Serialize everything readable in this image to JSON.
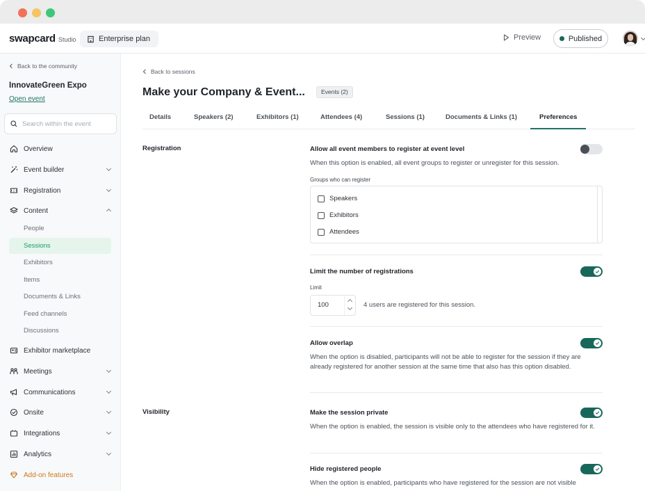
{
  "app": {
    "logo": "swapcard",
    "logo_sub": "Studio",
    "plan": "Enterprise plan",
    "preview": "Preview",
    "status": "Published",
    "colors": {
      "primary": "#18675a",
      "active_nav_bg": "#e5f5ec",
      "active_nav_text": "#1b9a6e",
      "addon": "#c97a1e"
    }
  },
  "sidebar": {
    "back": "Back to the community",
    "event_name": "InnovateGreen Expo",
    "open_event": "Open event",
    "search_placeholder": "Search within the event",
    "items": [
      {
        "label": "Overview",
        "icon": "home-icon"
      },
      {
        "label": "Event builder",
        "icon": "wand-icon"
      },
      {
        "label": "Registration",
        "icon": "ticket-icon"
      },
      {
        "label": "Content",
        "icon": "layers-icon"
      },
      {
        "label": "Exhibitor marketplace",
        "icon": "store-icon"
      },
      {
        "label": "Meetings",
        "icon": "people-icon"
      },
      {
        "label": "Communications",
        "icon": "megaphone-icon"
      },
      {
        "label": "Onsite",
        "icon": "badge-check-icon"
      },
      {
        "label": "Integrations",
        "icon": "plug-icon"
      },
      {
        "label": "Analytics",
        "icon": "chart-icon"
      },
      {
        "label": "Add-on features",
        "icon": "diamond-icon"
      }
    ],
    "content_subitems": [
      "People",
      "Sessions",
      "Exhibitors",
      "Items",
      "Documents & Links",
      "Feed channels",
      "Discussions"
    ]
  },
  "main": {
    "back": "Back to sessions",
    "title": "Make your Company & Event...",
    "badge": "Events (2)",
    "tabs": [
      "Details",
      "Speakers (2)",
      "Exhibitors (1)",
      "Attendees (4)",
      "Sessions (1)",
      "Documents & Links (1)",
      "Preferences"
    ],
    "sections": {
      "registration": "Registration",
      "visibility": "Visibility"
    },
    "settings": {
      "allow_all": {
        "title": "Allow all event members to register at event level",
        "desc": "When this option is enabled, all event groups to register or unregister for this session.",
        "enabled": false
      },
      "groups_label": "Groups who can register",
      "groups": [
        "Speakers",
        "Exhibitors",
        "Attendees"
      ],
      "limit": {
        "title": "Limit the number of registrations",
        "label": "Limit",
        "value": "100",
        "note": "4 users are registered for this session.",
        "enabled": true
      },
      "overlap": {
        "title": "Allow overlap",
        "desc": "When the option is disabled, participants will not be able to register for the session if they are already registered for another session at the same time that also has this option disabled.",
        "enabled": true
      },
      "private": {
        "title": "Make the session private",
        "desc": "When the option is enabled, the session is visible only to the attendees who have registered for it.",
        "enabled": true
      },
      "hide_registered": {
        "title": "Hide registered people",
        "desc": "When the option is enabled, participants who have registered for the session are not visible",
        "enabled": true
      }
    }
  }
}
